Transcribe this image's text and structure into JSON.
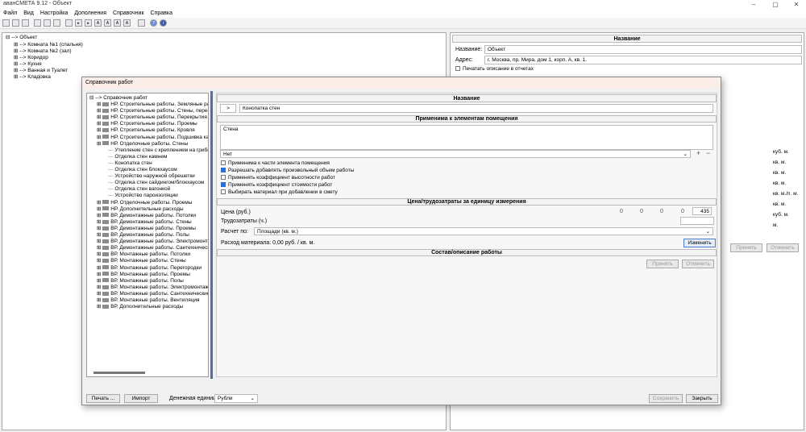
{
  "app": {
    "title": "аванСМЕТА 9.12 - Объект"
  },
  "menu": [
    "Файл",
    "Вид",
    "Настройка",
    "Дополнения",
    "Справочник",
    "Справка"
  ],
  "toolbar_icons": [
    "new-icon",
    "open-icon",
    "save-icon",
    "undo-icon",
    "print-icon",
    "preview-icon",
    "export-icon",
    "sel-icon",
    "arrow-icon",
    "a1-icon",
    "a2-icon",
    "a3-icon",
    "a4-icon",
    "a5-icon",
    "calc-icon",
    "help-icon"
  ],
  "object_tree": {
    "root": "Объект",
    "items": [
      "Комната №1 (спальня)",
      "Комната №2 (зал)",
      "Коридор",
      "Кухня",
      "Ванная и Туалет",
      "Кладовка"
    ]
  },
  "right_panel": {
    "header": "Название",
    "name_label": "Название:",
    "name_value": "Объект",
    "address_label": "Адрес:",
    "address_value": "г. Москва, пр. Мира, дом 1, корп. А, кв. 1.",
    "print_desc": "Печатать описание в отчетах",
    "units": [
      "куб. м.",
      "кв. м.",
      "кв. м.",
      "кв. м.",
      "кв. м./п. м.",
      "кв. м.",
      "куб. м.",
      "м."
    ],
    "apply": "Принять",
    "cancel": "Отменить"
  },
  "dialog": {
    "title": "Справочник работ",
    "tree_root": "Справочник работ",
    "tree": [
      {
        "label": "НР. Строительные работы. Земляные работы",
        "level": 1,
        "icon": "excavator-icon"
      },
      {
        "label": "НР. Строительные работы. Стены, перегородки",
        "level": 1,
        "icon": "wall-icon"
      },
      {
        "label": "НР. Строительные работы. Перекрытия",
        "level": 1,
        "icon": "slab-icon"
      },
      {
        "label": "НР. Строительные работы. Проемы",
        "level": 1,
        "icon": "opening-icon"
      },
      {
        "label": "НР. Строительные работы. Кровля",
        "level": 1,
        "icon": "roof-icon"
      },
      {
        "label": "НР. Строительные работы. Подшивка карниза",
        "level": 1,
        "icon": "eaves-icon"
      },
      {
        "label": "НР. Отделочные работы. Стены",
        "level": 1,
        "icon": "paint-icon"
      },
      {
        "label": "Утепление стен с креплением на грибы",
        "level": 2
      },
      {
        "label": "Отделка стен камнем",
        "level": 2
      },
      {
        "label": "Конопатка стен",
        "level": 2
      },
      {
        "label": "Отделка стен блокхаусом",
        "level": 2
      },
      {
        "label": "Устройство наружной обрешетки",
        "level": 2
      },
      {
        "label": "Отделка стен сайдингом/блокхаусом",
        "level": 2
      },
      {
        "label": "Отделка стен вагонкой",
        "level": 2
      },
      {
        "label": "Устройство пароизоляции",
        "level": 2
      },
      {
        "label": "НР. Отделочные работы. Проемы",
        "level": 1,
        "icon": "paint-icon"
      },
      {
        "label": "НР. Дополнительные расходы",
        "level": 1,
        "icon": "extra-icon"
      },
      {
        "label": "ВР. Демонтажные работы. Потолки",
        "level": 1,
        "icon": "hammer-icon"
      },
      {
        "label": "ВР. Демонтажные работы. Стены",
        "level": 1,
        "icon": "hammer-icon"
      },
      {
        "label": "ВР. Демонтажные работы. Проемы",
        "level": 1,
        "icon": "hammer-icon"
      },
      {
        "label": "ВР. Демонтажные работы. Полы",
        "level": 1,
        "icon": "hammer-icon"
      },
      {
        "label": "ВР. Демонтажные работы. Электромонтажные",
        "level": 1,
        "icon": "electric-icon"
      },
      {
        "label": "ВР. Демонтажные работы. Сантехнические",
        "level": 1,
        "icon": "plumbing-icon"
      },
      {
        "label": "ВР. Монтажные работы. Потолки",
        "level": 1,
        "icon": "trowel-icon"
      },
      {
        "label": "ВР. Монтажные работы. Стены",
        "level": 1,
        "icon": "trowel-icon"
      },
      {
        "label": "ВР. Монтажные работы. Перегородки",
        "level": 1,
        "icon": "trowel-icon"
      },
      {
        "label": "ВР. Монтажные работы. Проемы",
        "level": 1,
        "icon": "trowel-icon"
      },
      {
        "label": "ВР. Монтажные работы. Полы",
        "level": 1,
        "icon": "trowel-icon"
      },
      {
        "label": "ВР. Монтажные работы. Электромонтажные",
        "level": 1,
        "icon": "electric-icon"
      },
      {
        "label": "ВР. Монтажные работы. Сантехнические ра",
        "level": 1,
        "icon": "plumbing-icon"
      },
      {
        "label": "ВР. Монтажные работы. Вентиляция",
        "level": 1,
        "icon": "fan-icon"
      },
      {
        "label": "ВР. Дополнительные расходы",
        "level": 1,
        "icon": "extra-icon"
      }
    ],
    "name_header": "Название",
    "name_prefix": ">",
    "name_value": "Конопатка стен",
    "apply_header": "Применима к элементам помещения",
    "apply_element": "Стена",
    "dropdown_value": "Нет",
    "checkboxes": [
      {
        "label": "Применима к части элемента помещения",
        "checked": false
      },
      {
        "label": "Разрешать добавлять произвольный объем работы",
        "checked": true
      },
      {
        "label": "Применять коэффициент высотности работ",
        "checked": false
      },
      {
        "label": "Применять коэффициент стоимости работ",
        "checked": true
      },
      {
        "label": "Выбирать материал при добавлении в смету",
        "checked": false
      }
    ],
    "price_header": "Цена/трудозатраты за единицу измерения",
    "price_label": "Цена (руб.)",
    "price_values": [
      "0",
      "0",
      "0",
      "0",
      "435"
    ],
    "labor_label": "Трудозатраты (ч.)",
    "calc_label": "Расчет по:",
    "calc_value": "Площади (кв. м.)",
    "material_label": "Расход материала: 0,00 руб. / кв. м.",
    "change_btn": "Изменить",
    "composition_header": "Состав/описание работы",
    "apply_btn": "Принять",
    "cancel_btn": "Отменить",
    "print_btn": "Печать ...",
    "import_btn": "Импорт",
    "currency_label": "Денежная единица:",
    "currency_value": "Рубли",
    "save_btn": "Сохранить",
    "close_btn": "Закрыть"
  }
}
